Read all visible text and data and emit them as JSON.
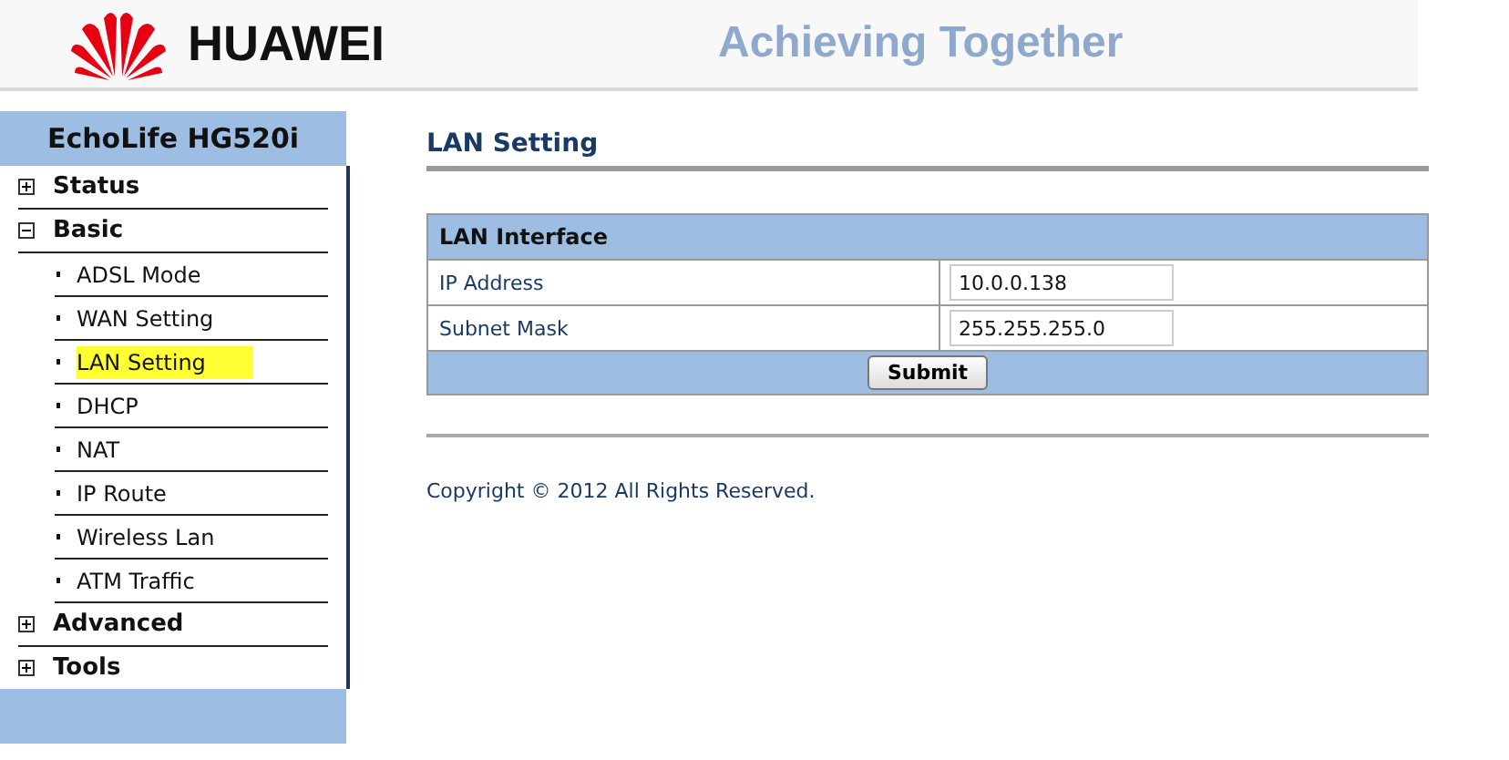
{
  "header": {
    "brand": "HUAWEI",
    "tagline": "Achieving Together"
  },
  "sidebar": {
    "title": "EchoLife HG520i",
    "menu": [
      {
        "label": "Status",
        "expanded": false
      },
      {
        "label": "Basic",
        "expanded": true,
        "children": [
          {
            "label": "ADSL Mode",
            "highlighted": false
          },
          {
            "label": "WAN Setting",
            "highlighted": false
          },
          {
            "label": "LAN Setting",
            "highlighted": true
          },
          {
            "label": "DHCP",
            "highlighted": false
          },
          {
            "label": "NAT",
            "highlighted": false
          },
          {
            "label": "IP Route",
            "highlighted": false
          },
          {
            "label": "Wireless Lan",
            "highlighted": false
          },
          {
            "label": "ATM Traffic",
            "highlighted": false
          }
        ]
      },
      {
        "label": "Advanced",
        "expanded": false
      },
      {
        "label": "Tools",
        "expanded": false
      }
    ]
  },
  "main": {
    "title": "LAN Setting",
    "section": "LAN Interface",
    "fields": [
      {
        "label": "IP Address",
        "value": "10.0.0.138"
      },
      {
        "label": "Subnet Mask",
        "value": "255.255.255.0"
      }
    ],
    "button": "Submit",
    "copyright": "Copyright © 2012 All Rights Reserved."
  }
}
